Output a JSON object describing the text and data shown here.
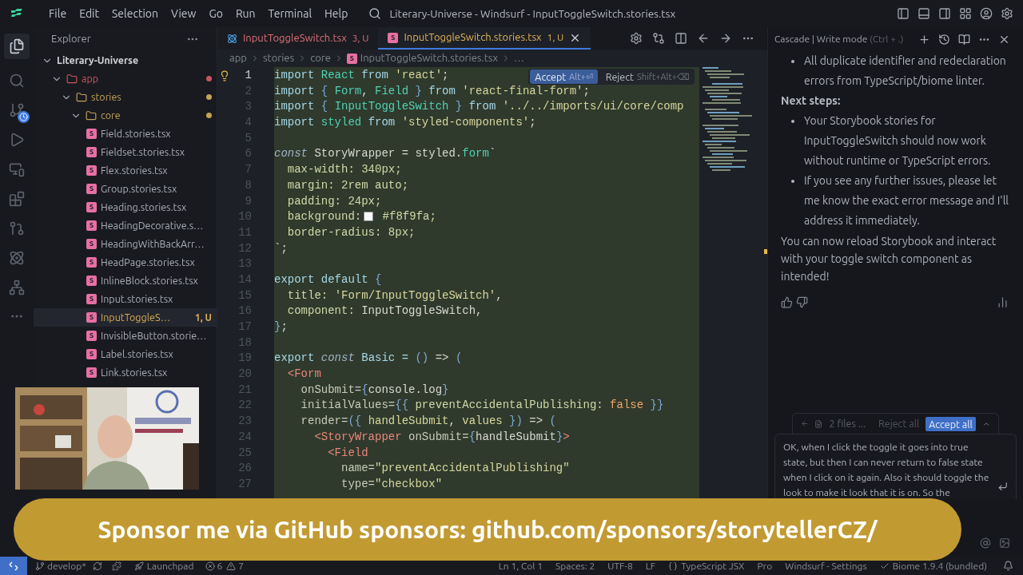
{
  "menu_bar": {
    "items": [
      "File",
      "Edit",
      "Selection",
      "View",
      "Go",
      "Run",
      "Terminal",
      "Help"
    ],
    "title": "Literary-Universe - Windsurf - InputToggleSwitch.stories.tsx"
  },
  "explorer": {
    "title": "Explorer",
    "tree": [
      {
        "label": "Literary-Universe",
        "kind": "root",
        "expanded": true,
        "children": [
          {
            "label": "app",
            "kind": "folder",
            "expanded": true,
            "color": "#c9565f",
            "children": [
              {
                "label": "stories",
                "kind": "folder",
                "expanded": true,
                "color": "#c4a257",
                "children": [
                  {
                    "label": "core",
                    "kind": "folder",
                    "expanded": true,
                    "color": "#c4a257",
                    "children": [
                      {
                        "label": "Field.stories.tsx",
                        "kind": "file",
                        "icon": "S",
                        "selected": false
                      },
                      {
                        "label": "Fieldset.stories.tsx",
                        "kind": "file",
                        "icon": "S",
                        "selected": false
                      },
                      {
                        "label": "Flex.stories.tsx",
                        "kind": "file",
                        "icon": "S",
                        "selected": false
                      },
                      {
                        "label": "Group.stories.tsx",
                        "kind": "file",
                        "icon": "S",
                        "selected": false
                      },
                      {
                        "label": "Heading.stories.tsx",
                        "kind": "file",
                        "icon": "S",
                        "selected": false
                      },
                      {
                        "label": "HeadingDecorative.s…",
                        "kind": "file",
                        "icon": "S",
                        "selected": false
                      },
                      {
                        "label": "HeadingWithBackArr…",
                        "kind": "file",
                        "icon": "S",
                        "selected": false
                      },
                      {
                        "label": "HeadPage.stories.tsx",
                        "kind": "file",
                        "icon": "S",
                        "selected": false
                      },
                      {
                        "label": "InlineBlock.stories.tsx",
                        "kind": "file",
                        "icon": "S",
                        "selected": false
                      },
                      {
                        "label": "Input.stories.tsx",
                        "kind": "file",
                        "icon": "S",
                        "selected": false
                      },
                      {
                        "label": "InputToggleS…",
                        "kind": "file",
                        "icon": "S",
                        "selected": true,
                        "badge": "1, U",
                        "color": "#d6ab52"
                      },
                      {
                        "label": "InvisibleButton.storie…",
                        "kind": "file",
                        "icon": "S",
                        "selected": false
                      },
                      {
                        "label": "Label.stories.tsx",
                        "kind": "file",
                        "icon": "S",
                        "selected": false
                      },
                      {
                        "label": "Link.stories.tsx",
                        "kind": "file",
                        "icon": "S",
                        "selected": false
                      }
                    ]
                  }
                ]
              }
            ]
          }
        ]
      }
    ]
  },
  "tabs": [
    {
      "label": "InputToggleSwitch.tsx",
      "badge": "3, U",
      "kind": "react",
      "selected": false,
      "color": "#e0707a"
    },
    {
      "label": "InputToggleSwitch.stories.tsx",
      "badge": "1, U",
      "kind": "story",
      "icon": "S",
      "selected": true,
      "color": "#e0b458"
    }
  ],
  "breadcrumbs": [
    {
      "label": "app"
    },
    {
      "label": "stories"
    },
    {
      "label": "core"
    },
    {
      "label": "InputToggleSwitch.stories.tsx",
      "icon": "S"
    },
    {
      "label": "…"
    }
  ],
  "diff_actions": {
    "accept": "Accept",
    "accept_keys": "Alt+⏎",
    "reject": "Reject",
    "reject_keys": "Shift+Alt+⌫"
  },
  "code_lines": [
    {
      "number": "1",
      "tokens": [
        {
          "kind": "kw",
          "text": "import "
        },
        {
          "kind": "id",
          "text": "React "
        },
        {
          "kind": "kw",
          "text": "from "
        },
        {
          "kind": "str",
          "text": "'react'"
        },
        {
          "kind": "plain",
          "text": ";"
        }
      ]
    },
    {
      "number": "2",
      "tokens": [
        {
          "kind": "kw",
          "text": "import "
        },
        {
          "kind": "punct",
          "text": "{ "
        },
        {
          "kind": "id",
          "text": "Form"
        },
        {
          "kind": "plain",
          "text": ", "
        },
        {
          "kind": "id",
          "text": "Field "
        },
        {
          "kind": "punct",
          "text": "} "
        },
        {
          "kind": "kw",
          "text": "from "
        },
        {
          "kind": "str",
          "text": "'react-final-form'"
        },
        {
          "kind": "plain",
          "text": ";"
        }
      ]
    },
    {
      "number": "3",
      "tokens": [
        {
          "kind": "kw",
          "text": "import "
        },
        {
          "kind": "punct",
          "text": "{ "
        },
        {
          "kind": "id",
          "text": "InputToggleSwitch "
        },
        {
          "kind": "punct",
          "text": "} "
        },
        {
          "kind": "kw",
          "text": "from "
        },
        {
          "kind": "str",
          "text": "'../../imports/ui/core/comp"
        }
      ]
    },
    {
      "number": "4",
      "tokens": [
        {
          "kind": "kw",
          "text": "import "
        },
        {
          "kind": "id",
          "text": "styled "
        },
        {
          "kind": "kw",
          "text": "from "
        },
        {
          "kind": "str",
          "text": "'styled-components'"
        },
        {
          "kind": "plain",
          "text": ";"
        }
      ]
    },
    {
      "number": "5"
    },
    {
      "number": "6",
      "tokens": [
        {
          "kind": "italic",
          "text": "const "
        },
        {
          "kind": "plain",
          "text": "StoryWrapper = styled."
        },
        {
          "kind": "id",
          "text": "form"
        },
        {
          "kind": "plain",
          "text": "`"
        }
      ]
    },
    {
      "number": "7",
      "tokens": [
        {
          "kind": "prop",
          "text": "  max-width: 340px;"
        }
      ]
    },
    {
      "number": "8",
      "tokens": [
        {
          "kind": "prop",
          "text": "  margin: 2rem auto;"
        }
      ]
    },
    {
      "number": "9",
      "tokens": [
        {
          "kind": "prop",
          "text": "  padding: 24px;"
        }
      ]
    },
    {
      "number": "10",
      "tokens": [
        {
          "kind": "prop",
          "text": "  background:"
        },
        {
          "kind": "swatch",
          "color": "#f8f9fa"
        },
        {
          "kind": "prop",
          "text": " #f8f9fa;"
        }
      ]
    },
    {
      "number": "11",
      "tokens": [
        {
          "kind": "prop",
          "text": "  border-radius: 8px;"
        }
      ]
    },
    {
      "number": "12",
      "tokens": [
        {
          "kind": "plain",
          "text": "`;"
        }
      ]
    },
    {
      "number": "13"
    },
    {
      "number": "14",
      "tokens": [
        {
          "kind": "kw",
          "text": "export default "
        },
        {
          "kind": "punct",
          "text": "{"
        }
      ]
    },
    {
      "number": "15",
      "tokens": [
        {
          "kind": "prop",
          "text": "  title: "
        },
        {
          "kind": "str",
          "text": "'Form/InputToggleSwitch'"
        },
        {
          "kind": "plain",
          "text": ","
        }
      ]
    },
    {
      "number": "16",
      "tokens": [
        {
          "kind": "prop",
          "text": "  component: "
        },
        {
          "kind": "plain",
          "text": "InputToggleSwitch,"
        }
      ]
    },
    {
      "number": "17",
      "tokens": [
        {
          "kind": "punct",
          "text": "}"
        },
        {
          "kind": "plain",
          "text": ";"
        }
      ]
    },
    {
      "number": "18"
    },
    {
      "number": "19",
      "tokens": [
        {
          "kind": "kw",
          "text": "export "
        },
        {
          "kind": "italic",
          "text": "const "
        },
        {
          "kind": "kw",
          "text": "Basic = "
        },
        {
          "kind": "punct",
          "text": "() "
        },
        {
          "kind": "plain",
          "text": "=> "
        },
        {
          "kind": "punct",
          "text": "("
        }
      ]
    },
    {
      "number": "20",
      "tokens": [
        {
          "kind": "tag",
          "text": "  <Form"
        }
      ]
    },
    {
      "number": "21",
      "tokens": [
        {
          "kind": "attr",
          "text": "    onSubmit="
        },
        {
          "kind": "punct",
          "text": "{"
        },
        {
          "kind": "plain",
          "text": "console.log"
        },
        {
          "kind": "punct",
          "text": "}"
        }
      ]
    },
    {
      "number": "22",
      "tokens": [
        {
          "kind": "attr",
          "text": "    initialValues="
        },
        {
          "kind": "punct",
          "text": "{{ "
        },
        {
          "kind": "prop",
          "text": "preventAccidentalPublishing: "
        },
        {
          "kind": "bool",
          "text": "false "
        },
        {
          "kind": "punct",
          "text": "}}"
        }
      ]
    },
    {
      "number": "23",
      "tokens": [
        {
          "kind": "attr",
          "text": "    render="
        },
        {
          "kind": "punct",
          "text": "({ "
        },
        {
          "kind": "str",
          "text": "handleSubmit"
        },
        {
          "kind": "plain",
          "text": ", "
        },
        {
          "kind": "str",
          "text": "values "
        },
        {
          "kind": "punct",
          "text": "}) "
        },
        {
          "kind": "plain",
          "text": "=> "
        },
        {
          "kind": "punct",
          "text": "("
        }
      ]
    },
    {
      "number": "24",
      "tokens": [
        {
          "kind": "tag",
          "text": "      <StoryWrapper "
        },
        {
          "kind": "attr",
          "text": "onSubmit="
        },
        {
          "kind": "punct",
          "text": "{"
        },
        {
          "kind": "plain",
          "text": "handleSubmit"
        },
        {
          "kind": "punct",
          "text": "}"
        },
        {
          "kind": "tag",
          "text": ">"
        }
      ]
    },
    {
      "number": "25",
      "tokens": [
        {
          "kind": "tag",
          "text": "        <Field"
        }
      ]
    },
    {
      "number": "26",
      "tokens": [
        {
          "kind": "attr",
          "text": "          name="
        },
        {
          "kind": "str",
          "text": "\"preventAccidentalPublishing\""
        }
      ]
    },
    {
      "number": "27",
      "tokens": [
        {
          "kind": "attr",
          "text": "          type="
        },
        {
          "kind": "str",
          "text": "\"checkbox\""
        }
      ]
    }
  ],
  "cascade": {
    "title": "Cascade | Write mode",
    "shortcut": "(Ctrl + .)",
    "messages": [
      {
        "kind": "bullet",
        "text": "All duplicate identifier and redeclaration errors from TypeScript/biome linter."
      },
      {
        "kind": "heading",
        "text": "Next steps:"
      },
      {
        "kind": "bullet",
        "text": "Your Storybook stories for InputToggleSwitch should now work without runtime or TypeScript errors."
      },
      {
        "kind": "bullet",
        "text": "If you see any further issues, please let me know the exact error message and I'll address it immediately."
      },
      {
        "kind": "paragraph",
        "text": "You can now reload Storybook and interact with your toggle switch component as intended!"
      }
    ],
    "changes": {
      "label": "2 files ...",
      "reject": "Reject all",
      "accept": "Accept all"
    },
    "input": {
      "value": "OK, when I click the toggle it goes into true state, but then I can never return to false state when I click on it again. Also it should toggle the look to make it look that it is on. So the"
    }
  },
  "banner": {
    "text": "Sponsor me via GitHub sponsors: github.com/sponsors/storytellerCZ/"
  },
  "status_bar": {
    "left": [
      {
        "kind": "branch",
        "text": "develop*"
      },
      {
        "kind": "launchpad",
        "text": "Launchpad"
      },
      {
        "kind": "problems",
        "errors": "6",
        "warnings": "7"
      }
    ],
    "right": [
      {
        "kind": "text",
        "text": "Ln 1, Col 1"
      },
      {
        "kind": "text",
        "text": "Spaces: 2"
      },
      {
        "kind": "text",
        "text": "UTF-8"
      },
      {
        "kind": "text",
        "text": "LF"
      },
      {
        "kind": "language",
        "text": "TypeScript JSX"
      },
      {
        "kind": "text",
        "text": "Pro"
      },
      {
        "kind": "text",
        "text": "Windsurf - Settings"
      },
      {
        "kind": "check",
        "text": "Biome 1.9.4 (bundled)"
      },
      {
        "kind": "bell"
      }
    ]
  }
}
